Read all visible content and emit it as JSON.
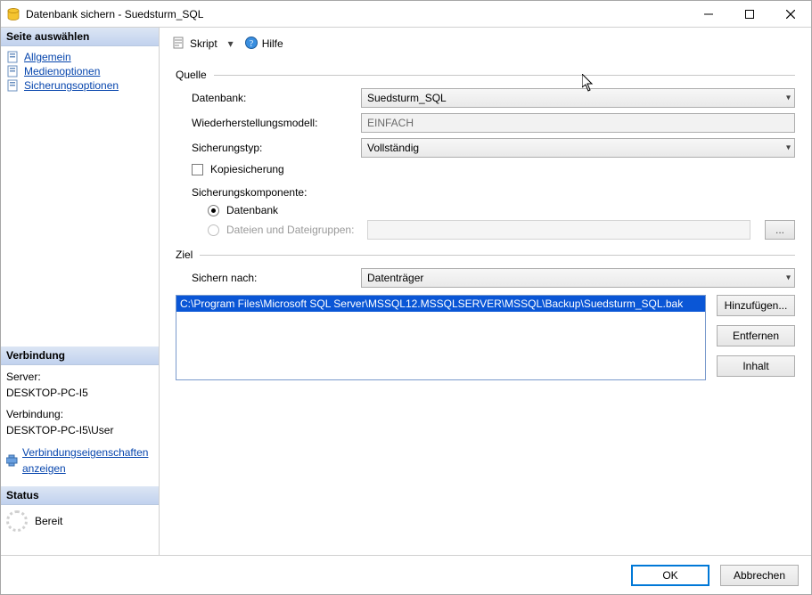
{
  "window": {
    "title": "Datenbank sichern - Suedsturm_SQL"
  },
  "sidebar": {
    "pages_header": "Seite auswählen",
    "pages": [
      {
        "label": "Allgemein"
      },
      {
        "label": "Medienoptionen"
      },
      {
        "label": "Sicherungsoptionen"
      }
    ],
    "connection_header": "Verbindung",
    "server_label": "Server:",
    "server_value": "DESKTOP-PC-I5",
    "conn_label": "Verbindung:",
    "conn_value": "DESKTOP-PC-I5\\User",
    "conn_props_link": "Verbindungseigenschaften anzeigen",
    "status_header": "Status",
    "status_value": "Bereit"
  },
  "toolbar": {
    "script_label": "Skript",
    "help_label": "Hilfe"
  },
  "source": {
    "group": "Quelle",
    "database_label": "Datenbank:",
    "database_value": "Suedsturm_SQL",
    "recovery_label": "Wiederherstellungsmodell:",
    "recovery_value": "EINFACH",
    "backup_type_label": "Sicherungstyp:",
    "backup_type_value": "Vollständig",
    "copy_only_label": "Kopiesicherung",
    "component_header": "Sicherungskomponente:",
    "radio_db": "Datenbank",
    "radio_files": "Dateien und Dateigruppen:"
  },
  "destination": {
    "group": "Ziel",
    "backup_to_label": "Sichern nach:",
    "backup_to_value": "Datenträger",
    "paths": [
      "C:\\Program Files\\Microsoft SQL Server\\MSSQL12.MSSQLSERVER\\MSSQL\\Backup\\Suedsturm_SQL.bak"
    ],
    "add_btn": "Hinzufügen...",
    "remove_btn": "Entfernen",
    "content_btn": "Inhalt"
  },
  "footer": {
    "ok": "OK",
    "cancel": "Abbrechen"
  },
  "ellipsis": "..."
}
